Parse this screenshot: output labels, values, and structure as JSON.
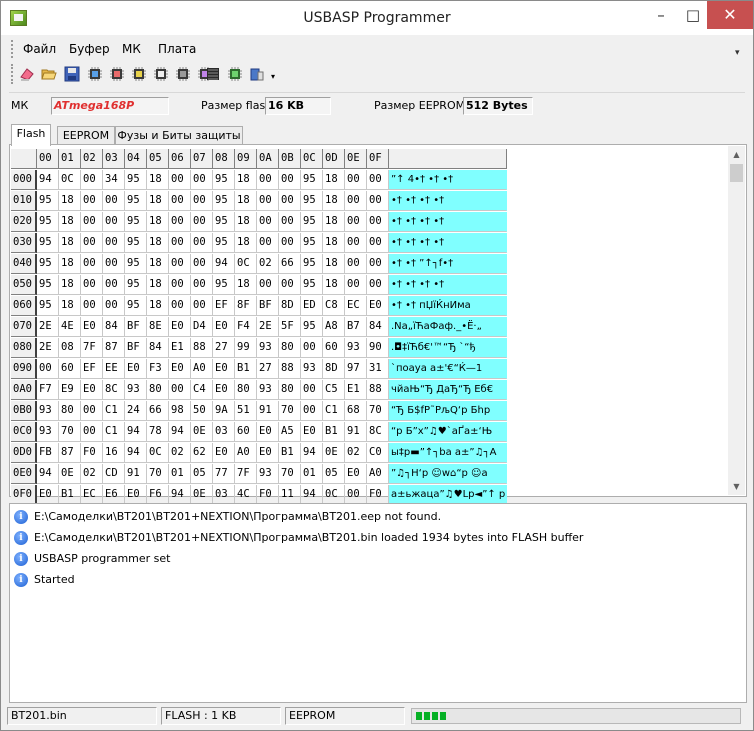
{
  "window": {
    "title": "USBASP Programmer"
  },
  "menu": [
    "Файл",
    "Буфер",
    "МК",
    "Плата"
  ],
  "toolbar_icons": [
    "erase-icon",
    "open-folder-icon",
    "save-disk-icon",
    "chip-read-icon",
    "chip-write-icon",
    "chip-verify-icon",
    "chip-erase-icon",
    "chip-blank-check-icon",
    "chip-auto-icon",
    "programmer-icon",
    "chip-green-icon",
    "device-info-icon",
    "dropdown-arrow-icon"
  ],
  "info": {
    "mk_label": "МК",
    "mk_value": "ATmega168P",
    "mk_color": "#e03030",
    "flash_label": "Размер flash",
    "flash_value": "16 KB",
    "eeprom_label": "Размер EEPROM",
    "eeprom_value": "512 Bytes"
  },
  "tabs": [
    "Flash",
    "EEPROM",
    "Фузы и Биты защиты"
  ],
  "hex": {
    "columns": [
      "00",
      "01",
      "02",
      "03",
      "04",
      "05",
      "06",
      "07",
      "08",
      "09",
      "0A",
      "0B",
      "0C",
      "0D",
      "0E",
      "0F"
    ],
    "rows": [
      {
        "addr": "000",
        "bytes": [
          "94",
          "0C",
          "00",
          "34",
          "95",
          "18",
          "00",
          "00",
          "95",
          "18",
          "00",
          "00",
          "95",
          "18",
          "00",
          "00"
        ],
        "ascii": "”↑ 4•†  •†  •†"
      },
      {
        "addr": "010",
        "bytes": [
          "95",
          "18",
          "00",
          "00",
          "95",
          "18",
          "00",
          "00",
          "95",
          "18",
          "00",
          "00",
          "95",
          "18",
          "00",
          "00"
        ],
        "ascii": "•†  •†  •†  •†"
      },
      {
        "addr": "020",
        "bytes": [
          "95",
          "18",
          "00",
          "00",
          "95",
          "18",
          "00",
          "00",
          "95",
          "18",
          "00",
          "00",
          "95",
          "18",
          "00",
          "00"
        ],
        "ascii": "•†  •†  •†  •†"
      },
      {
        "addr": "030",
        "bytes": [
          "95",
          "18",
          "00",
          "00",
          "95",
          "18",
          "00",
          "00",
          "95",
          "18",
          "00",
          "00",
          "95",
          "18",
          "00",
          "00"
        ],
        "ascii": "•†  •†  •†  •†"
      },
      {
        "addr": "040",
        "bytes": [
          "95",
          "18",
          "00",
          "00",
          "95",
          "18",
          "00",
          "00",
          "94",
          "0C",
          "02",
          "66",
          "95",
          "18",
          "00",
          "00"
        ],
        "ascii": "•†  •†  ”↑┐f•†"
      },
      {
        "addr": "050",
        "bytes": [
          "95",
          "18",
          "00",
          "00",
          "95",
          "18",
          "00",
          "00",
          "95",
          "18",
          "00",
          "00",
          "95",
          "18",
          "00",
          "00"
        ],
        "ascii": "•†  •†  •†  •†"
      },
      {
        "addr": "060",
        "bytes": [
          "95",
          "18",
          "00",
          "00",
          "95",
          "18",
          "00",
          "00",
          "EF",
          "8F",
          "BF",
          "8D",
          "ED",
          "C8",
          "EC",
          "E0"
        ],
        "ascii": "•†  •†  пЏїЌнИма"
      },
      {
        "addr": "070",
        "bytes": [
          "2E",
          "4E",
          "E0",
          "84",
          "BF",
          "8E",
          "E0",
          "D4",
          "E0",
          "F4",
          "2E",
          "5F",
          "95",
          "A8",
          "B7",
          "84"
        ],
        "ascii": ".Nа„їЋаФаф._•Ё·„"
      },
      {
        "addr": "080",
        "bytes": [
          "2E",
          "08",
          "7F",
          "87",
          "BF",
          "84",
          "E1",
          "88",
          "27",
          "99",
          "93",
          "80",
          "00",
          "60",
          "93",
          "90"
        ],
        "ascii": ".◘‡їЋб€'™“Ђ `“ђ"
      },
      {
        "addr": "090",
        "bytes": [
          "00",
          "60",
          "EF",
          "EE",
          "E0",
          "F3",
          "E0",
          "A0",
          "E0",
          "B1",
          "27",
          "88",
          "93",
          "8D",
          "97",
          "31"
        ],
        "ascii": " `поауа а±'€“Ќ—1"
      },
      {
        "addr": "0A0",
        "bytes": [
          "F7",
          "E9",
          "E0",
          "8C",
          "93",
          "80",
          "00",
          "C4",
          "E0",
          "80",
          "93",
          "80",
          "00",
          "C5",
          "E1",
          "88"
        ],
        "ascii": "чйаЊ“Ђ ДаЂ“Ђ Еб€"
      },
      {
        "addr": "0B0",
        "bytes": [
          "93",
          "80",
          "00",
          "C1",
          "24",
          "66",
          "98",
          "50",
          "9A",
          "51",
          "91",
          "70",
          "00",
          "C1",
          "68",
          "70"
        ],
        "ascii": "“Ђ Б$fР˜PљQ‘p Бhp"
      },
      {
        "addr": "0C0",
        "bytes": [
          "93",
          "70",
          "00",
          "C1",
          "94",
          "78",
          "94",
          "0E",
          "03",
          "60",
          "E0",
          "A5",
          "E0",
          "B1",
          "91",
          "8C"
        ],
        "ascii": "“p Б”x”♫♥`аҐа±‘Њ"
      },
      {
        "addr": "0D0",
        "bytes": [
          "FB",
          "87",
          "F0",
          "16",
          "94",
          "0C",
          "02",
          "62",
          "E0",
          "A0",
          "E0",
          "B1",
          "94",
          "0E",
          "02",
          "C0"
        ],
        "ascii": "ы‡р▬”↑┐bа а±”♫┐А"
      },
      {
        "addr": "0E0",
        "bytes": [
          "94",
          "0E",
          "02",
          "CD",
          "91",
          "70",
          "01",
          "05",
          "77",
          "7F",
          "93",
          "70",
          "01",
          "05",
          "E0",
          "A0"
        ],
        "ascii": "”♫┐Н‘p ☺w⌂“p ☺а "
      },
      {
        "addr": "0F0",
        "bytes": [
          "E0",
          "B1",
          "EC",
          "E6",
          "E0",
          "F6",
          "94",
          "0E",
          "03",
          "4C",
          "F0",
          "11",
          "94",
          "0C",
          "00",
          "F0"
        ],
        "ascii": "а±ьжацa”♫♥Lр◄”↑ р"
      }
    ]
  },
  "log": [
    "E:\\Самоделки\\BT201\\BT201+NEXTION\\Программа\\BT201.eep not found.",
    "E:\\Самоделки\\BT201\\BT201+NEXTION\\Программа\\BT201.bin loaded 1934 bytes into FLASH buffer",
    "USBASP programmer set",
    "Started"
  ],
  "status": {
    "file": "BT201.bin",
    "flash": "FLASH : 1 KB",
    "eeprom": "EEPROM",
    "progress_fraction": 0.1
  }
}
